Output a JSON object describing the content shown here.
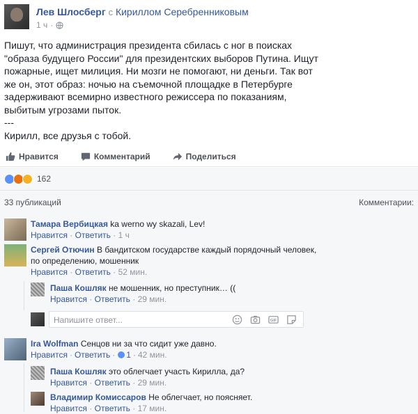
{
  "post": {
    "author": "Лев Шлосберг",
    "with_word": "с",
    "tagged": "Кириллом Серебренниковым",
    "time": "1 ч",
    "text_lines": [
      "Пишут, что администрация президента сбилась с ног в поисках",
      "\"образа будущего России\" для президентских выборов Путина. Ищут",
      "пожарные, ищет милиция. Ни мозги не помогают, ни деньги. Так вот",
      "же он, этот образ: ночью на съемочной площадке в Петербурге",
      "задерживают всемирно известного режиссера по показаниям,",
      "выбитым угрозами пыток.",
      "---",
      "Кирилл, все друзья с тобой."
    ]
  },
  "actions": {
    "like": "Нравится",
    "comment": "Комментарий",
    "share": "Поделиться"
  },
  "reactions": {
    "count": "162"
  },
  "comments_header": {
    "shares": "33 публикаций",
    "label": "Комментарии:"
  },
  "comments": [
    {
      "author": "Тамара Вербицкая",
      "text": "ka werno wy skazali, Lev!",
      "like": "Нравится",
      "reply": "Ответить",
      "time": "1 ч"
    },
    {
      "author": "Сергей Отючин",
      "text1": "В бандитском государстве каждый порядочный человек,",
      "text2": "по определению, мошенник",
      "like": "Нравится",
      "reply": "Ответить",
      "time": "52 мин."
    },
    {
      "author": "Паша Кошляк",
      "text": "не мошенник, но преступник… ((",
      "like": "Нравится",
      "reply": "Ответить",
      "time": "29 мин."
    },
    {
      "author": "Ira Wolfman",
      "text": "Сенцов ни за что сидит уже давно.",
      "like": "Нравится",
      "reply": "Ответить",
      "likes": "1",
      "time": "42 мин."
    },
    {
      "author": "Паша Кошляк",
      "text": "это облегчает участь Кирилла, да?",
      "like": "Нравится",
      "reply": "Ответить",
      "time": "29 мин."
    },
    {
      "author": "Владимир Комиссаров",
      "text": "Не облегчает, но поясняет.",
      "like": "Нравится",
      "reply": "Ответить",
      "time": "17 мин."
    }
  ],
  "reply_box": {
    "placeholder": "Напишите ответ..."
  },
  "colors": {
    "link": "#365899",
    "meta": "#90949c",
    "bg_comments": "#f6f7f9"
  }
}
